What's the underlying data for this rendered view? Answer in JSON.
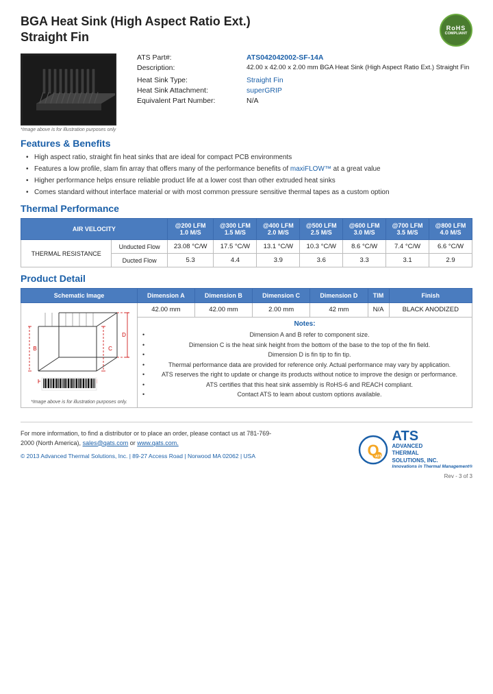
{
  "page": {
    "title_line1": "BGA Heat Sink (High Aspect Ratio Ext.)",
    "title_line2": "Straight Fin",
    "rohs": {
      "line1": "RoHS",
      "line2": "COMPLIANT"
    },
    "image_caption": "*Image above is for illustration purposes only",
    "part_label": "ATS Part#:",
    "part_number": "ATS042042002-SF-14A",
    "description_label": "Description:",
    "description_value": "42.00 x 42.00 x 2.00 mm  BGA Heat Sink (High Aspect Ratio Ext.) Straight Fin",
    "heat_sink_type_label": "Heat Sink Type:",
    "heat_sink_type_value": "Straight Fin",
    "attachment_label": "Heat Sink Attachment:",
    "attachment_value": "superGRIP",
    "equivalent_label": "Equivalent Part Number:",
    "equivalent_value": "N/A",
    "features_heading": "Features & Benefits",
    "features": [
      "High aspect ratio, straight fin heat sinks that are ideal for compact PCB environments",
      "Features a low profile, slam fin array that offers many of the performance benefits of maxiFLOW™ at a great value",
      "Higher performance helps ensure reliable product life at a lower cost than other extruded heat sinks",
      "Comes standard without interface material or with most common pressure sensitive thermal tapes as a custom option"
    ],
    "maxiflow_link": "maxiFLOW™",
    "thermal_heading": "Thermal Performance",
    "thermal_table": {
      "col_header_airvel": "AIR VELOCITY",
      "columns": [
        "@200 LFM\n1.0 M/S",
        "@300 LFM\n1.5 M/S",
        "@400 LFM\n2.0 M/S",
        "@500 LFM\n2.5 M/S",
        "@600 LFM\n3.0 M/S",
        "@700 LFM\n3.5 M/S",
        "@800 LFM\n4.0 M/S"
      ],
      "row_label": "THERMAL RESISTANCE",
      "rows": [
        {
          "label": "Unducted Flow",
          "values": [
            "23.08 °C/W",
            "17.5 °C/W",
            "13.1 °C/W",
            "10.3 °C/W",
            "8.6 °C/W",
            "7.4 °C/W",
            "6.6 °C/W"
          ]
        },
        {
          "label": "Ducted Flow",
          "values": [
            "5.3",
            "4.4",
            "3.9",
            "3.6",
            "3.3",
            "3.1",
            "2.9"
          ]
        }
      ]
    },
    "product_detail_heading": "Product Detail",
    "detail_table": {
      "headers": [
        "Schematic Image",
        "Dimension A",
        "Dimension B",
        "Dimension C",
        "Dimension D",
        "TIM",
        "Finish"
      ],
      "dim_a": "42.00 mm",
      "dim_b": "42.00 mm",
      "dim_c": "2.00 mm",
      "dim_d": "42 mm",
      "tim": "N/A",
      "finish": "BLACK ANODIZED",
      "schematic_caption": "*Image above is for illustration purposes only.",
      "notes_heading": "Notes:",
      "notes": [
        "Dimension A and B refer to component size.",
        "Dimension C is the heat sink height from the bottom of the base to the top of the fin field.",
        "Dimension D is fin tip to fin tip.",
        "Thermal performance data are provided for reference only. Actual performance may vary by application.",
        "ATS reserves the right to update or change its products without notice to improve the design or performance.",
        "ATS certifies that this heat sink assembly is RoHS-6 and REACH compliant.",
        "Contact ATS to learn about custom options available."
      ]
    },
    "footer": {
      "contact_text": "For more information, to find a distributor or to place an order, please contact us at",
      "phone": "781-769-2000 (North America),",
      "email": "sales@qats.com",
      "or_text": " or ",
      "website": "www.qats.com.",
      "copyright": "© 2013 Advanced Thermal Solutions, Inc. | 89-27 Access Road | Norwood MA  02062 | USA",
      "ats_big": "ATS",
      "ats_full": "ADVANCED\nTHERMAL\nSOLUTIONS, INC.",
      "ats_slogan": "Innovations in Thermal Management®",
      "page_num": "Rev - 3 of 3"
    }
  }
}
